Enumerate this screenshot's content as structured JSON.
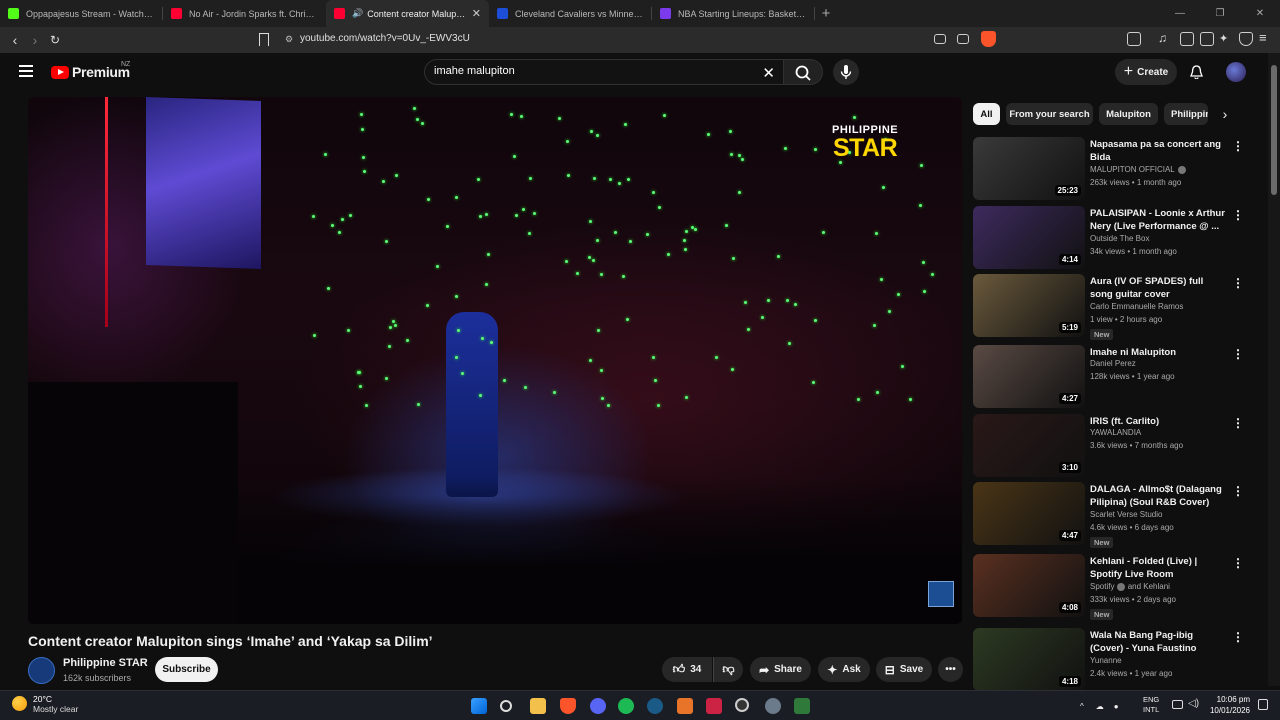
{
  "browser": {
    "tabs": [
      {
        "title": "Oppapajesus Stream - Watch Live on",
        "color": "#53fc18",
        "active": false
      },
      {
        "title": "No Air - Jordin Sparks ft. Chris Brown",
        "color": "#ff0033",
        "active": false
      },
      {
        "title": "Content creator Malupiton sin",
        "color": "#ff0033",
        "active": true
      },
      {
        "title": "Cleveland Cavaliers vs Minnesota Tim",
        "color": "#1d4ed8",
        "active": false
      },
      {
        "title": "NBA Starting Lineups: Basketball Dai",
        "color": "#7c3aed",
        "active": false
      }
    ],
    "new_tab": "+",
    "url": "youtube.com/watch?v=0Uv_-EWV3cU"
  },
  "youtube": {
    "logo_text": "Premium",
    "region": "NZ",
    "search_value": "imahe malupiton",
    "create_label": "Create",
    "video": {
      "overlay_brand_top": "PHILIPPINE",
      "overlay_brand_bottom": "STAR",
      "title": "Content creator Malupiton sings ‘Imahe’ and ‘Yakap sa Dilim’",
      "channel": "Philippine STAR",
      "subscribers": "162k subscribers",
      "subscribe_label": "Subscribe",
      "likes": "34",
      "share_label": "Share",
      "ask_label": "Ask",
      "save_label": "Save"
    },
    "chips": [
      "All",
      "From your search",
      "Malupiton",
      "Philippin"
    ],
    "recommendations": [
      {
        "title": "Napasama pa sa concert ang Bida",
        "channel": "MALUPITON OFFICIAL",
        "verified": true,
        "meta": "263k views • 1 month ago",
        "duration": "25:23",
        "new": false,
        "thumb_color": "#3a3a3a"
      },
      {
        "title": "PALAISIPAN - Loonie x Arthur Nery (Live Performance @ ...",
        "channel": "Outside The Box",
        "verified": false,
        "meta": "34k views • 1 month ago",
        "duration": "4:14",
        "new": false,
        "thumb_color": "#3d2a5e"
      },
      {
        "title": "Aura (IV OF SPADES) full song guitar cover",
        "channel": "Carlo Emmanuelle Ramos",
        "verified": false,
        "meta": "1 view • 2 hours ago",
        "duration": "5:19",
        "new": true,
        "thumb_color": "#6b5a3c"
      },
      {
        "title": "Imahe ni Malupiton",
        "channel": "Daniel Perez",
        "verified": false,
        "meta": "128k views • 1 year ago",
        "duration": "4:27",
        "new": false,
        "thumb_color": "#5a4a44"
      },
      {
        "title": "IRIS (ft. Carlito)",
        "channel": "YAWALANDIA",
        "verified": false,
        "meta": "3.6k views • 7 months ago",
        "duration": "3:10",
        "new": false,
        "thumb_color": "#2a1818"
      },
      {
        "title": "DALAGA - Allmo$t (Dalagang Pilipina) (Soul R&B Cover)",
        "channel": "Scarlet Verse Studio",
        "verified": false,
        "meta": "4.6k views • 6 days ago",
        "duration": "4:47",
        "new": true,
        "thumb_color": "#4a3516"
      },
      {
        "title": "Kehlani - Folded (Live) | Spotify Live Room",
        "channel": "Spotify",
        "channel_extra": "and Kehlani",
        "verified": true,
        "meta": "333k views • 2 days ago",
        "duration": "4:08",
        "new": true,
        "thumb_color": "#5a3020"
      },
      {
        "title": "Wala Na Bang Pag-ibig (Cover) - Yuna Faustino",
        "channel": "Yunanne",
        "verified": false,
        "meta": "2.4k views • 1 year ago",
        "duration": "4:18",
        "new": false,
        "thumb_color": "#2d3a22"
      }
    ],
    "new_badge": "New"
  },
  "taskbar": {
    "temp": "20°C",
    "weather": "Mostly clear",
    "lang1": "ENG",
    "lang2": "INTL",
    "time": "10:06 pm",
    "date": "10/01/2026"
  }
}
